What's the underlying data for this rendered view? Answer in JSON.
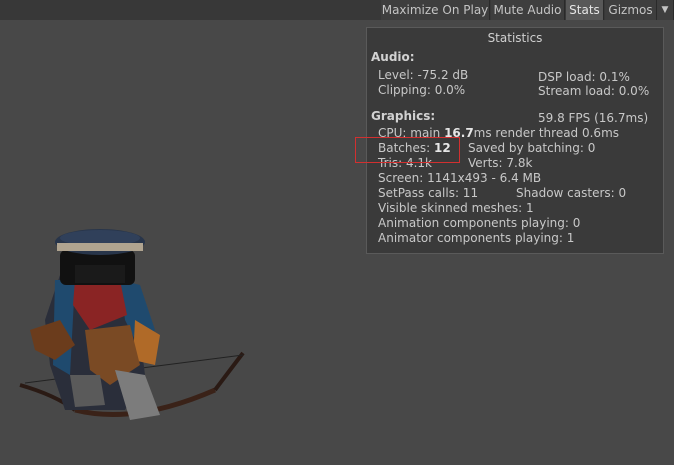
{
  "toolbar": {
    "maximize_label": "Maximize On Play",
    "mute_label": "Mute Audio",
    "stats_label": "Stats",
    "gizmos_label": "Gizmos",
    "dropdown_glyph": "▼"
  },
  "stats": {
    "title": "Statistics",
    "audio": {
      "header": "Audio:",
      "level": "Level: -75.2 dB",
      "clipping": "Clipping: 0.0%",
      "dsp_load": "DSP load: 0.1%",
      "stream_load": "Stream load: 0.0%"
    },
    "graphics": {
      "header": "Graphics:",
      "fps": "59.8 FPS (16.7ms)",
      "cpu_prefix": "CPU: main ",
      "cpu_main": "16.7",
      "cpu_suffix": "ms  render thread 0.6ms",
      "batches_prefix": "Batches: ",
      "batches_value": "12",
      "saved_by_batching": "Saved by batching: 0",
      "tris": "Tris: 4.1k",
      "verts": "Verts: 7.8k",
      "screen": "Screen: 1141x493 - 6.4 MB",
      "setpass": "SetPass calls: 11",
      "shadow_casters": "Shadow casters: 0",
      "skinned_meshes": "Visible skinned meshes: 1",
      "animation_components": "Animation components playing: 0",
      "animator_components": "Animator components playing: 1"
    }
  },
  "colors": {
    "viewport_bg": "#484848",
    "panel_bg": "#3a3a3a",
    "highlight": "#d23030"
  }
}
